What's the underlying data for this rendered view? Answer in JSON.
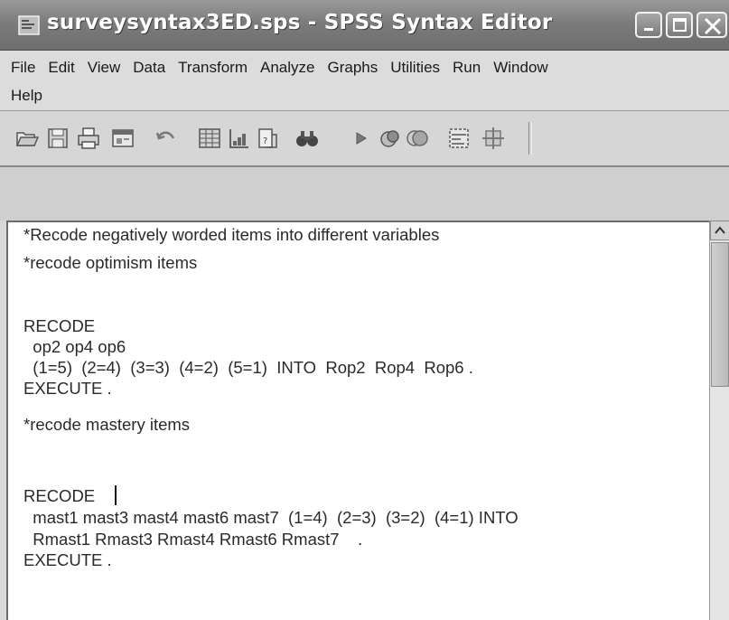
{
  "window": {
    "title": "surveysyntax3ED.sps - SPSS Syntax Editor"
  },
  "menu": {
    "row1": [
      "File",
      "Edit",
      "View",
      "Data",
      "Transform",
      "Analyze",
      "Graphs",
      "Utilities",
      "Run",
      "Window"
    ],
    "row2": [
      "Help"
    ]
  },
  "toolbar": {
    "icons": [
      "open-icon",
      "save-icon",
      "print-icon",
      "dialog-recall-icon",
      "undo-icon",
      "goto-data-icon",
      "variables-icon",
      "chart-icon",
      "find-icon",
      "run-icon",
      "use-sets-icon",
      "show-all-icon",
      "split-file-icon",
      "designate-window-icon"
    ]
  },
  "editor": {
    "lines": [
      "*Recode negatively worded items into different variables",
      "",
      "*recode optimism items",
      "",
      "RECODE",
      "  op2 op4 op6",
      "  (1=5)  (2=4)  (3=3)  (4=2)  (5=1)  INTO  Rop2  Rop4  Rop6 .",
      "EXECUTE .",
      "",
      "*recode mastery items",
      "",
      "RECODE",
      "  mast1 mast3 mast4 mast6 mast7  (1=4)  (2=3)  (3=2)  (4=1) INTO",
      "  Rmast1 Rmast3 Rmast4 Rmast6 Rmast7    .",
      "EXECUTE ."
    ]
  },
  "colors": {
    "titlebar": "#7c7c7c",
    "title_text": "#ffffff",
    "editor_bg": "#ffffff",
    "code_text": "#2a2a2a"
  }
}
